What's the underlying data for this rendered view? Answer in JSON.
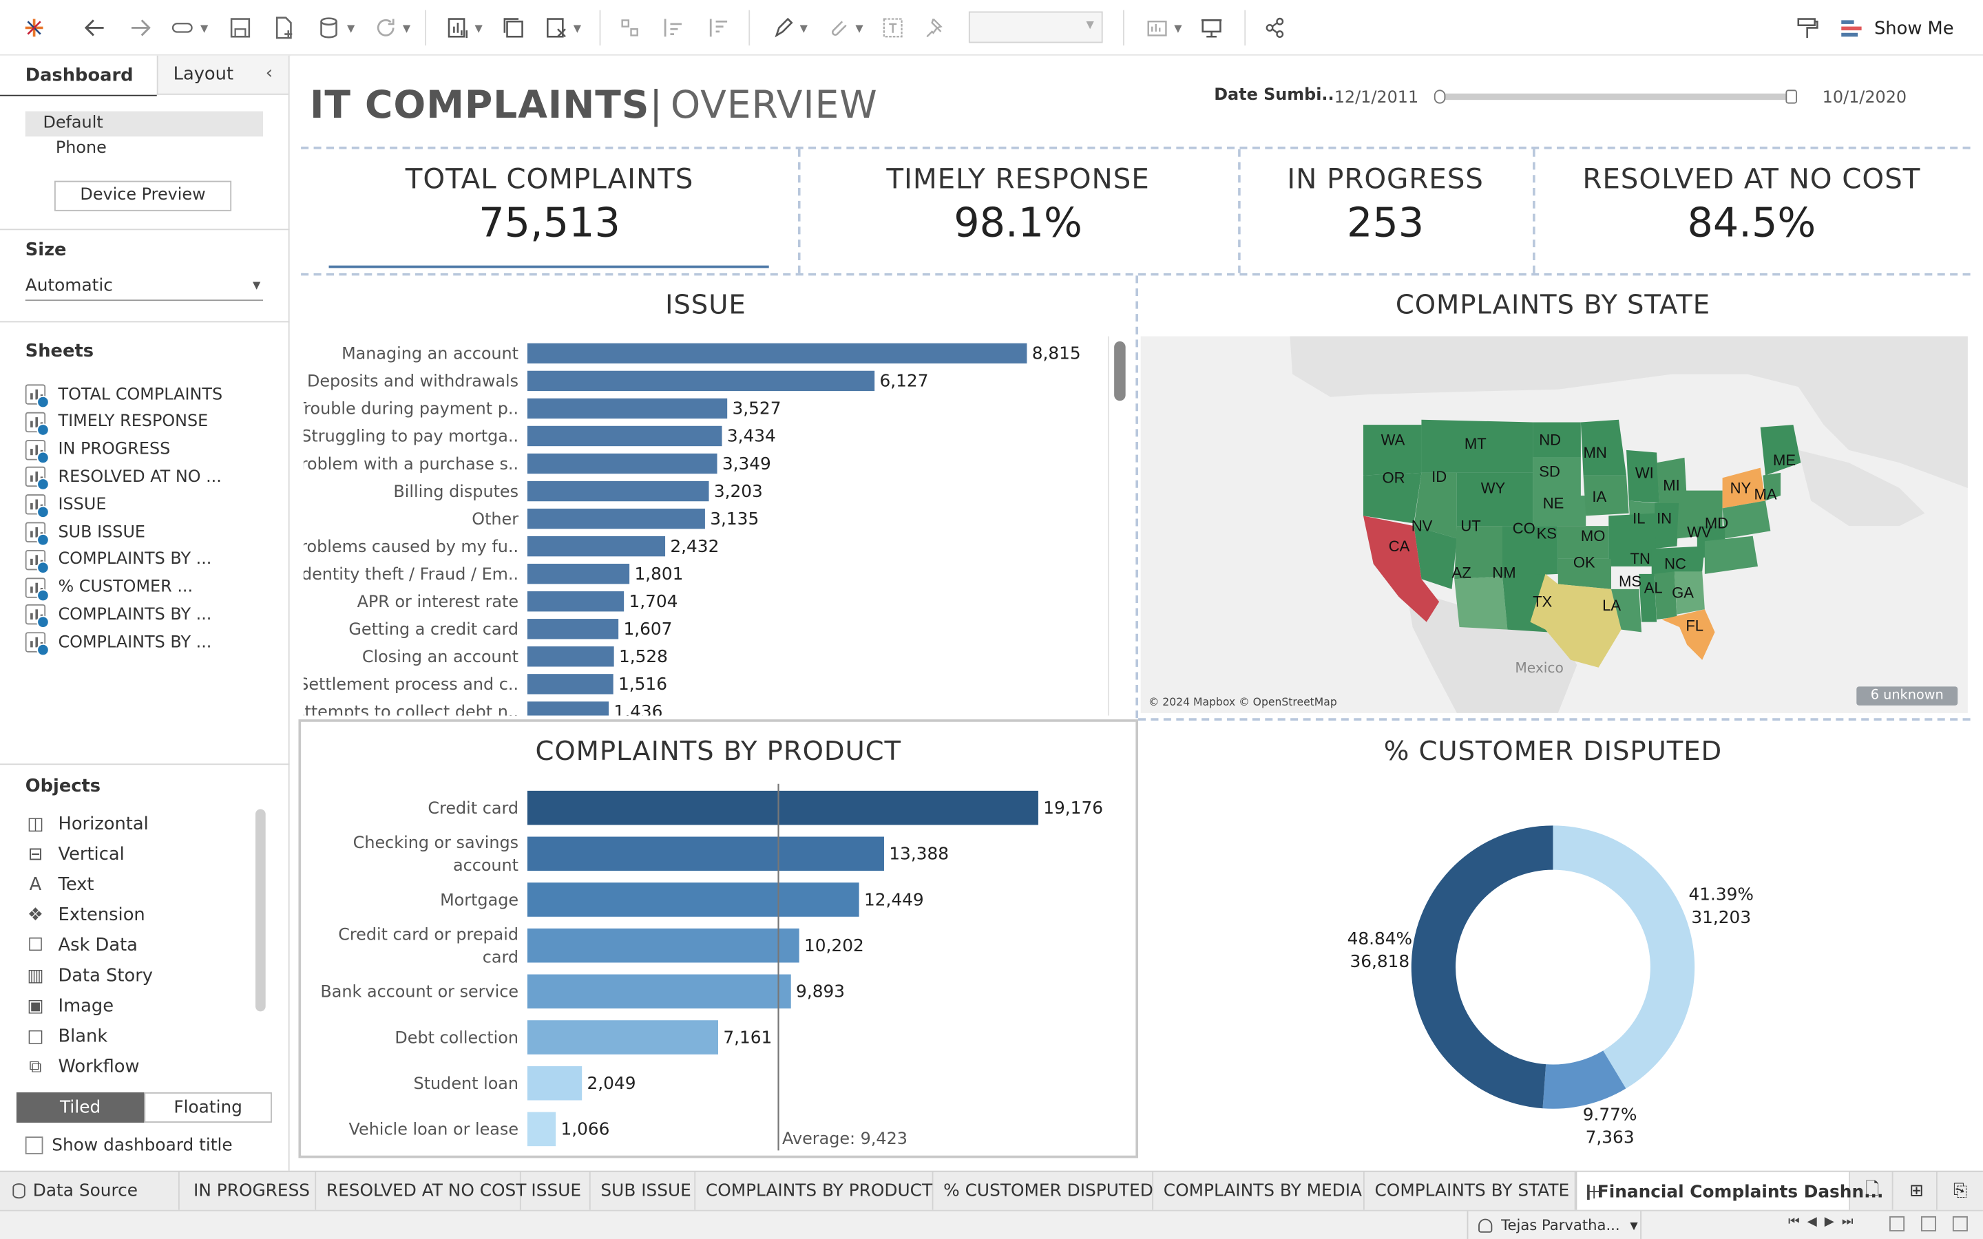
{
  "toolbar": {
    "show_me": "Show Me"
  },
  "left_panel": {
    "tabs": {
      "dashboard": "Dashboard",
      "layout": "Layout"
    },
    "device": {
      "default": "Default",
      "phone": "Phone",
      "preview_button": "Device Preview"
    },
    "size": {
      "title": "Size",
      "value": "Automatic"
    },
    "sheets": {
      "title": "Sheets",
      "items": [
        "TOTAL COMPLAINTS",
        "TIMELY RESPONSE",
        "IN PROGRESS",
        "RESOLVED AT NO ...",
        "ISSUE",
        "SUB ISSUE",
        "COMPLAINTS BY ...",
        "% CUSTOMER ...",
        "COMPLAINTS BY ...",
        "COMPLAINTS BY ..."
      ]
    },
    "objects": {
      "title": "Objects",
      "items": [
        "Horizontal",
        "Vertical",
        "Text",
        "Extension",
        "Ask Data",
        "Data Story",
        "Image",
        "Blank",
        "Workflow"
      ]
    },
    "layout_mode": {
      "tiled": "Tiled",
      "floating": "Floating"
    },
    "show_title": "Show dashboard title"
  },
  "dashboard": {
    "title_main": "IT COMPLAINTS",
    "title_sep": "|",
    "title_sub": "OVERVIEW",
    "date_filter": {
      "label": "Date Sumbi..",
      "start": "12/1/2011",
      "end": "10/1/2020"
    },
    "kpis": [
      {
        "title": "TOTAL COMPLAINTS",
        "value": "75,513"
      },
      {
        "title": "TIMELY RESPONSE",
        "value": "98.1%"
      },
      {
        "title": "IN PROGRESS",
        "value": "253"
      },
      {
        "title": "RESOLVED AT NO COST",
        "value": "84.5%"
      }
    ],
    "issue_title": "ISSUE",
    "state_title": "COMPLAINTS BY STATE",
    "product_title": "COMPLAINTS BY PRODUCT",
    "disputed_title": "% CUSTOMER DISPUTED",
    "map": {
      "attribution": "© 2024 Mapbox © OpenStreetMap",
      "unknown_badge": "6 unknown",
      "mexico_label": "Mexico",
      "states": [
        "WA",
        "MT",
        "ND",
        "MN",
        "ME",
        "OR",
        "ID",
        "WY",
        "SD",
        "WI",
        "MI",
        "NY",
        "MA",
        "NE",
        "IA",
        "IL",
        "IN",
        "NV",
        "UT",
        "CO",
        "KS",
        "MO",
        "WV",
        "MD",
        "CA",
        "OK",
        "TN",
        "NC",
        "AZ",
        "NM",
        "MS",
        "AL",
        "GA",
        "TX",
        "LA",
        "FL"
      ]
    }
  },
  "chart_data": [
    {
      "type": "bar",
      "title": "ISSUE",
      "categories": [
        "Managing an account",
        "Deposits and withdrawals",
        "Trouble during payment p..",
        "Struggling to pay mortga..",
        "Problem with a purchase s..",
        "Billing disputes",
        "Other",
        "Problems caused by my fu..",
        "Identity theft / Fraud / Em..",
        "APR or interest rate",
        "Getting a credit card",
        "Closing an account",
        "Settlement process and c..",
        "Attempts to collect debt n.."
      ],
      "values": [
        8815,
        6127,
        3527,
        3434,
        3349,
        3203,
        3135,
        2432,
        1801,
        1704,
        1607,
        1528,
        1516,
        1436
      ],
      "labels": [
        "8,815",
        "6,127",
        "3,527",
        "3,434",
        "3,349",
        "3,203",
        "3,135",
        "2,432",
        "1,801",
        "1,704",
        "1,607",
        "1,528",
        "1,516",
        "1,436"
      ],
      "color": "#4e79a7"
    },
    {
      "type": "bar",
      "title": "COMPLAINTS BY PRODUCT",
      "categories": [
        "Credit card",
        "Checking or savings account",
        "Mortgage",
        "Credit card or prepaid card",
        "Bank account or service",
        "Debt collection",
        "Student loan",
        "Vehicle loan or lease"
      ],
      "values": [
        19176,
        13388,
        12449,
        10202,
        9893,
        7161,
        2049,
        1066
      ],
      "labels": [
        "19,176",
        "13,388",
        "12,449",
        "10,202",
        "9,893",
        "7,161",
        "2,049",
        "1,066"
      ],
      "average": 9423,
      "average_label": "Average: 9,423",
      "colors": [
        "#2a5783",
        "#3f72a4",
        "#4a81b4",
        "#5c93c4",
        "#6ba1cf",
        "#7fb2da",
        "#aed6f1",
        "#b8ddf4"
      ]
    },
    {
      "type": "pie",
      "title": "% CUSTOMER DISPUTED",
      "slices": [
        {
          "value": 31203,
          "percent": "41.39%",
          "count": "31,203",
          "color": "#b9dcf2"
        },
        {
          "value": 7363,
          "percent": "9.77%",
          "count": "7,363",
          "color": "#5d93c9"
        },
        {
          "value": 36818,
          "percent": "48.84%",
          "count": "36,818",
          "color": "#2a5783"
        }
      ]
    }
  ],
  "tabs": {
    "data_source": "Data Source",
    "sheets": [
      "IN PROGRESS",
      "RESOLVED AT NO COST",
      "ISSUE",
      "SUB ISSUE",
      "COMPLAINTS BY PRODUCT",
      "% CUSTOMER DISPUTED",
      "COMPLAINTS BY MEDIA",
      "COMPLAINTS BY STATE"
    ],
    "active": "Financial Complaints Dashn..."
  },
  "status": {
    "user": "Tejas Parvatha..."
  }
}
